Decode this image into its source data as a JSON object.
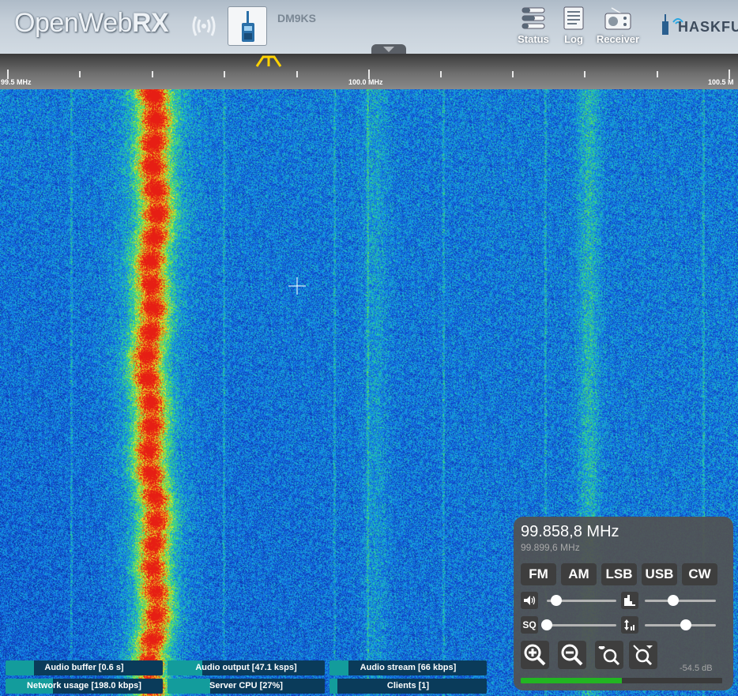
{
  "header": {
    "logo_text": "OpenWeb",
    "logo_rx": "RX",
    "callsign": "DM9KS",
    "buttons": [
      {
        "label": "Status",
        "icon": "status-icon"
      },
      {
        "label": "Log",
        "icon": "log-icon"
      },
      {
        "label": "Receiver",
        "icon": "receiver-icon"
      }
    ],
    "partner_logo_text": "HASKFU"
  },
  "scale": {
    "labels": [
      "99.5 MHz",
      "100.0 MHz",
      "100.5 M"
    ]
  },
  "status_bars": [
    {
      "label": "Audio buffer [0.6 s]",
      "fill": 0.18
    },
    {
      "label": "Audio output [47.1 ksps]",
      "fill": 0.22
    },
    {
      "label": "Audio stream [66 kbps]",
      "fill": 0.12
    },
    {
      "label": "Network usage [198.0 kbps]",
      "fill": 0.3
    },
    {
      "label": "Server CPU [27%]",
      "fill": 0.27
    },
    {
      "label": "Clients [1]",
      "fill": 0.05
    }
  ],
  "receiver": {
    "frequency": "99.858,8 MHz",
    "center_frequency": "99.899,6 MHz",
    "modes": [
      "FM",
      "AM",
      "LSB",
      "USB",
      "CW"
    ],
    "squelch_label": "SQ",
    "volume_level": 0.14,
    "nr_level": 0.4,
    "squelch_level": 0.0,
    "gain_level": 0.58,
    "db_readout": "-54.5 dB",
    "smeter_level": 0.5
  },
  "colors": {
    "accent": "#139c9c",
    "status_bg": "#0a3b5a",
    "filter_marker": "#ffd200",
    "smeter": "#22b522"
  }
}
